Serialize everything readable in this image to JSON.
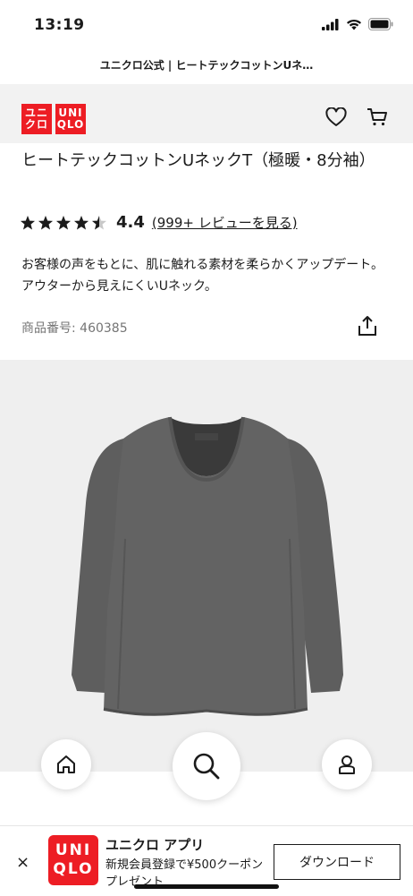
{
  "status_bar": {
    "time": "13:19"
  },
  "url_bar": {
    "title": "ユニクロ公式 | ヒートテックコットンUネ…"
  },
  "header": {
    "logo_top": "ユニ",
    "logo_bottom": "クロ",
    "logo2_top": "UNI",
    "logo2_bottom": "QLO"
  },
  "product": {
    "title": "ヒートテックコットンUネックT（極暖・8分袖）",
    "rating_value": "4.4",
    "review_link": "(999+ レビューを見る)",
    "description": "お客様の声をもとに、肌に触れる素材を柔らかくアップデート。アウターから見えにくいUネック。",
    "sku": "商品番号: 460385",
    "rating": 4.4,
    "shirt_color": "#5e5e5e"
  },
  "app_banner": {
    "close": "×",
    "logo_top": "UNI",
    "logo_bottom": "QLO",
    "name": "ユニクロ アプリ",
    "subtitle": "新規会員登録で¥500クーポンプレゼント",
    "download_label": "ダウンロード"
  },
  "colors": {
    "brand_red": "#ed1d24",
    "header_bg": "#f2f2f2",
    "image_bg": "#efefef"
  }
}
